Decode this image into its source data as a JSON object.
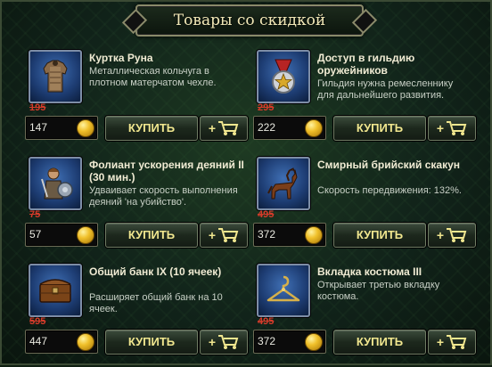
{
  "title": "Товары со скидкой",
  "buy_label": "КУПИТЬ",
  "items": [
    {
      "name": "Куртка Руна",
      "desc": "Металлическая кольчуга в плотном матерчатом чехле.",
      "old_price": "195",
      "price": "147",
      "icon": "armor-icon"
    },
    {
      "name": "Доступ в гильдию оружейников",
      "desc": "Гильдия нужна ремесленнику для дальнейшего развития.",
      "old_price": "295",
      "price": "222",
      "icon": "medal-icon"
    },
    {
      "name": "Фолиант ускорения деяний II (30 мин.)",
      "desc": "Удваивает скорость выполнения деяний 'на убийство'.",
      "old_price": "75",
      "price": "57",
      "icon": "warrior-icon"
    },
    {
      "name": "Смирный брийский скакун",
      "desc": "Скорость передвижения: 132%.",
      "old_price": "495",
      "price": "372",
      "icon": "horse-icon"
    },
    {
      "name": "Общий банк IX (10 ячеек)",
      "desc": "Расширяет общий банк на 10 ячеек.",
      "old_price": "595",
      "price": "447",
      "icon": "chest-icon"
    },
    {
      "name": "Вкладка костюма III",
      "desc": "Открывает третью вкладку костюма.",
      "old_price": "495",
      "price": "372",
      "icon": "hanger-icon"
    }
  ]
}
